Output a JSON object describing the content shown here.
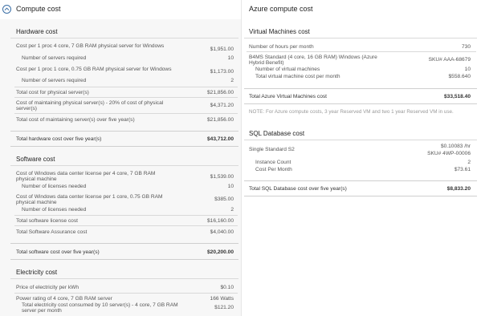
{
  "header": {
    "left_title": "Compute cost",
    "right_title": "Azure compute cost",
    "collapse_icon": "chevron-up-icon"
  },
  "hardware": {
    "title": "Hardware cost",
    "rows": [
      {
        "label": "Cost per 1 proc 4 core, 7 GB RAM physical server for Windows",
        "value": "$1,951.00"
      },
      {
        "label": "Number of servers required",
        "value": "10"
      },
      {
        "label": "Cost per 1 proc 1 core, 0.75 GB RAM physical server for Windows",
        "value": "$1,173.00"
      },
      {
        "label": "Number of servers required",
        "value": "2"
      },
      {
        "label": "Total cost for physical server(s)",
        "value": "$21,856.00"
      },
      {
        "label": "Cost of maintaining physical server(s) - 20% of cost of physical server(s)",
        "value": "$4,371.20"
      },
      {
        "label": "Total cost of maintaining server(s) over five year(s)",
        "value": "$21,856.00"
      }
    ],
    "total_label": "Total hardware cost over five year(s)",
    "total_value": "$43,712.00"
  },
  "software": {
    "title": "Software cost",
    "rows": [
      {
        "label": "Cost of Windows data center license per 4 core, 7 GB RAM physical machine",
        "value": "$1,539.00"
      },
      {
        "label": "Number of licenses needed",
        "value": "10"
      },
      {
        "label": "Cost of Windows data center license per 1 core, 0.75 GB RAM physical machine",
        "value": "$385.00"
      },
      {
        "label": "Number of licenses needed",
        "value": "2"
      },
      {
        "label": "Total software license cost",
        "value": "$16,160.00"
      },
      {
        "label": "Total Software Assurance cost",
        "value": "$4,040.00"
      }
    ],
    "total_label": "Total software cost over five year(s)",
    "total_value": "$20,200.00"
  },
  "electricity": {
    "title": "Electricity cost",
    "rows": [
      {
        "label": "Price of electricity per kWh",
        "value": "$0.10"
      },
      {
        "label": "Power rating of 4 core, 7 GB RAM server",
        "value": "166 Watts"
      },
      {
        "label": "Total electricity cost consumed by 10 server(s) - 4 core, 7 GB RAM server per month",
        "value": "$121.20"
      }
    ]
  },
  "vm": {
    "title": "Virtual Machines cost",
    "hours_label": "Number of hours per month",
    "hours_value": "730",
    "sku_label": "B4MS Standard (4 core, 16 GB RAM) Windows (Azure Hybrid Benefit)",
    "sku_value": "SKU# AAA-68679",
    "num_label": "Number of virtual machines",
    "num_value": "10",
    "monthly_label": "Total virtual machine cost per month",
    "monthly_value": "$558.640",
    "total_label": "Total Azure Virtual Machines cost",
    "total_value": "$33,518.40",
    "note": "NOTE: For Azure compute costs, 3 year Reserved VM and two 1 year Reserved VM in use."
  },
  "sql": {
    "title": "SQL Database cost",
    "tier_label": "Single Standard S2",
    "rate_value": "$0.10083 /hr",
    "sku_value": "SKU# 4WP-00006",
    "instance_label": "Instance Count",
    "instance_value": "2",
    "month_label": "Cost Per Month",
    "month_value": "$73.61",
    "total_label": "Total SQL Database cost over five year(s)",
    "total_value": "$8,833.20"
  }
}
